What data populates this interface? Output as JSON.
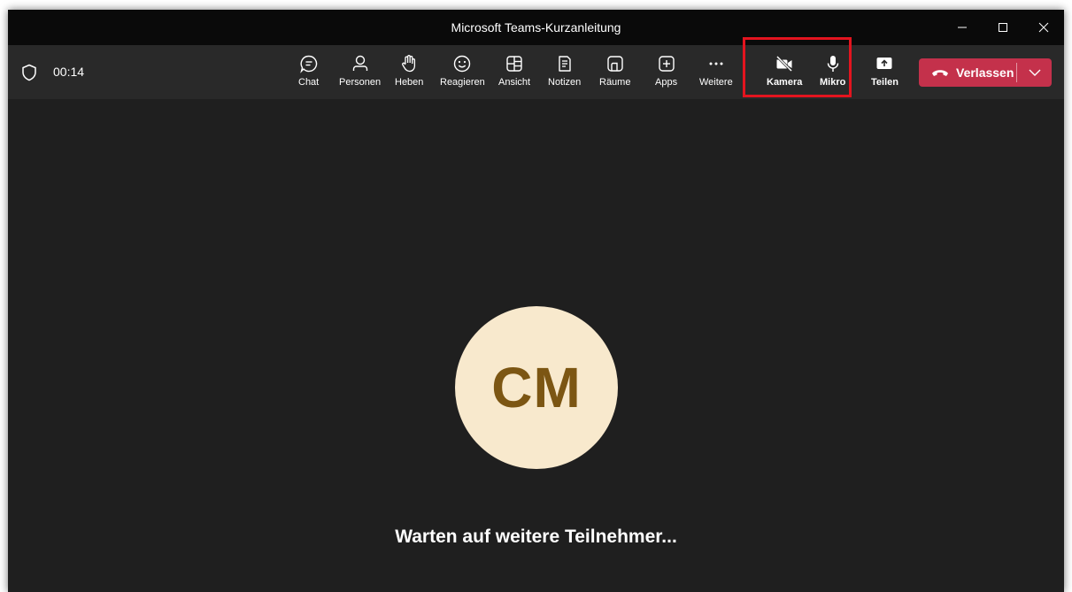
{
  "window": {
    "title": "Microsoft Teams-Kurzanleitung"
  },
  "toolbar": {
    "timer": "00:14",
    "buttons": [
      {
        "label": "Chat",
        "icon": "chat-icon"
      },
      {
        "label": "Personen",
        "icon": "people-icon"
      },
      {
        "label": "Heben",
        "icon": "raise-hand-icon"
      },
      {
        "label": "Reagieren",
        "icon": "react-emoji-icon"
      },
      {
        "label": "Ansicht",
        "icon": "view-layout-icon"
      },
      {
        "label": "Notizen",
        "icon": "notes-icon"
      },
      {
        "label": "Räume",
        "icon": "breakout-rooms-icon"
      },
      {
        "label": "Apps",
        "icon": "apps-add-icon"
      },
      {
        "label": "Weitere",
        "icon": "more-ellipsis-icon"
      },
      {
        "label": "Kamera",
        "icon": "camera-off-icon"
      },
      {
        "label": "Mikro",
        "icon": "microphone-icon"
      },
      {
        "label": "Teilen",
        "icon": "share-screen-icon"
      }
    ],
    "leave": {
      "label": "Verlassen",
      "icon": "hang-up-icon",
      "color": "#c4314b"
    }
  },
  "stage": {
    "avatar_initials": "CM",
    "avatar_bg": "#f8e9cd",
    "avatar_fg": "#7c5613",
    "waiting_text": "Warten auf weitere Teilnehmer..."
  },
  "highlight_color": "#e3141f"
}
